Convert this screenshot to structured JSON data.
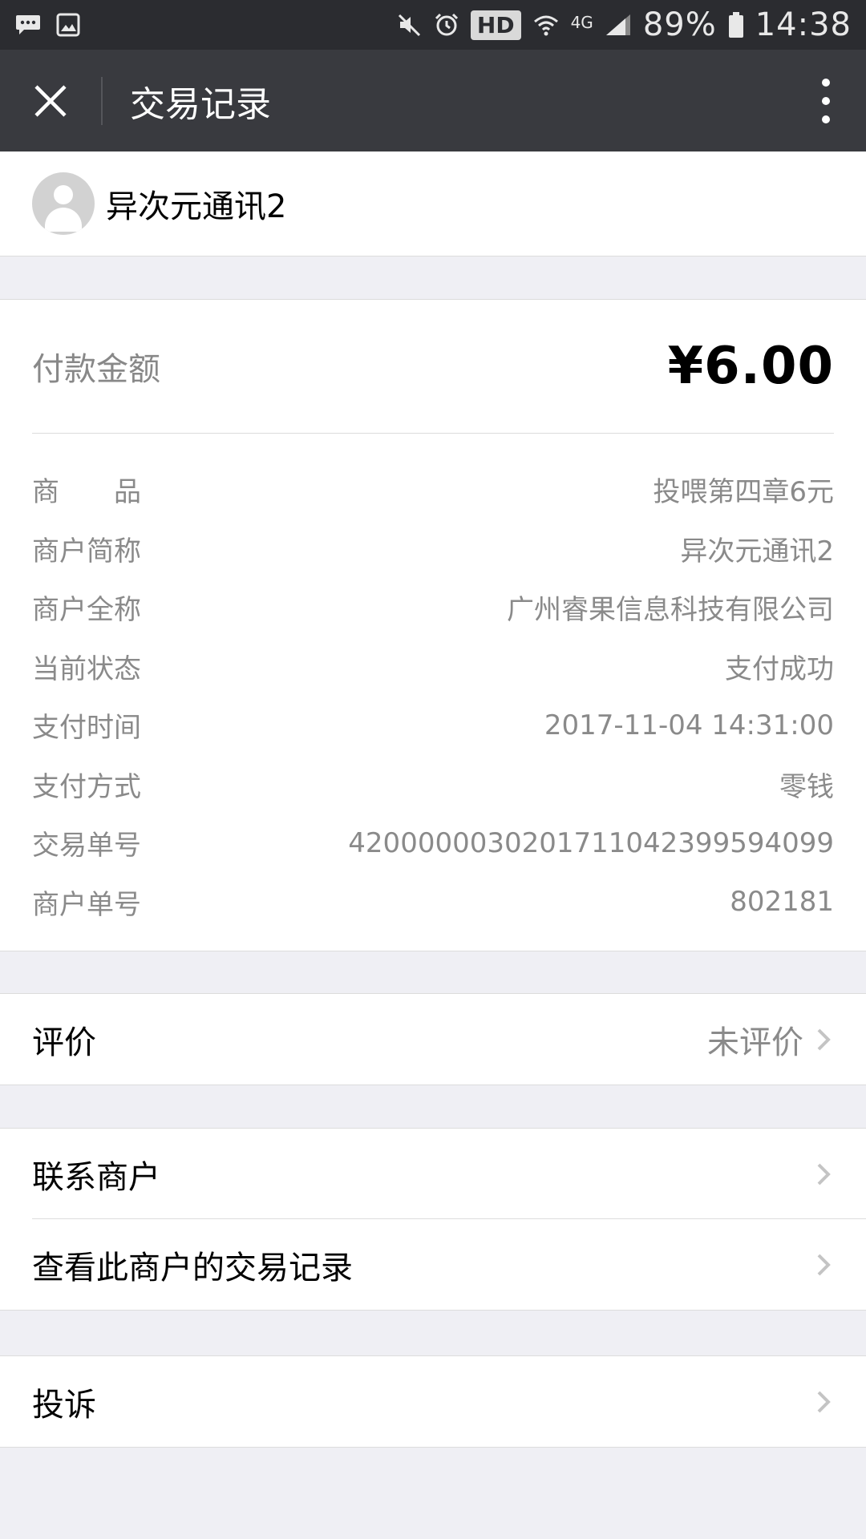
{
  "status_bar": {
    "battery": "89%",
    "time": "14:38",
    "hd": "HD",
    "network": "4G",
    "icons": [
      "message-icon",
      "image-icon",
      "mute-icon",
      "alarm-icon",
      "wifi-icon",
      "signal-icon",
      "battery-icon"
    ]
  },
  "nav": {
    "title": "交易记录",
    "close_icon": "close-icon",
    "more_icon": "more-vertical-icon"
  },
  "merchant": {
    "name": "异次元通讯2",
    "avatar_icon": "avatar-icon"
  },
  "payment": {
    "amount_label": "付款金额",
    "amount": "¥6.00",
    "details": [
      {
        "label": "商　　品",
        "value": "投喂第四章6元"
      },
      {
        "label": "商户简称",
        "value": "异次元通讯2"
      },
      {
        "label": "商户全称",
        "value": "广州睿果信息科技有限公司"
      },
      {
        "label": "当前状态",
        "value": "支付成功"
      },
      {
        "label": "支付时间",
        "value": "2017-11-04 14:31:00"
      },
      {
        "label": "支付方式",
        "value": "零钱"
      },
      {
        "label": "交易单号",
        "value": "4200000030201711042399594099"
      },
      {
        "label": "商户单号",
        "value": "802181"
      }
    ]
  },
  "rating": {
    "label": "评价",
    "value": "未评价"
  },
  "merchant_actions": [
    {
      "label": "联系商户"
    },
    {
      "label": "查看此商户的交易记录"
    }
  ],
  "complaint": {
    "label": "投诉"
  },
  "colors": {
    "status_bar_bg": "#2b2c30",
    "nav_bg": "#393a3f",
    "page_bg": "#efeff4",
    "secondary_text": "#8a8a8a"
  }
}
